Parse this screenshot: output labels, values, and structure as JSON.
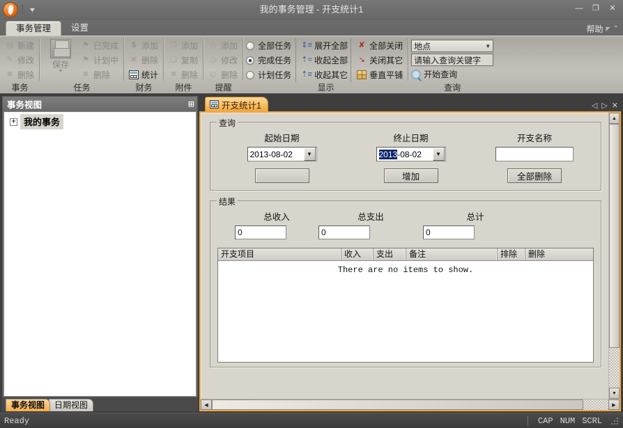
{
  "window": {
    "title": "我的事务管理 - 开支统计1",
    "minimize": "—",
    "maximize": "❐",
    "close": "✕",
    "quick_access_caret": "▼"
  },
  "ribbon": {
    "tabs": [
      {
        "label": "事务管理",
        "active": true
      },
      {
        "label": "设置",
        "active": false
      }
    ],
    "help_label": "帮助",
    "groups": [
      {
        "name": "事务",
        "items": [
          {
            "label": "新建",
            "icon": "new-document-icon",
            "glyph": "◰",
            "enabled": false
          },
          {
            "label": "修改",
            "icon": "edit-icon",
            "glyph": "✎",
            "enabled": false
          },
          {
            "label": "删除",
            "icon": "delete-icon",
            "glyph": "✖",
            "enabled": false
          }
        ]
      },
      {
        "name": "任务",
        "big": {
          "label": "保存",
          "icon": "save-disk-icon",
          "enabled": false
        },
        "items": [
          {
            "label": "已完成",
            "icon": "flag-done-icon",
            "glyph": "⚑",
            "enabled": false
          },
          {
            "label": "计划中",
            "icon": "flag-planned-icon",
            "glyph": "⚑",
            "enabled": false
          },
          {
            "label": "删除",
            "icon": "delete-icon",
            "glyph": "✖",
            "enabled": false
          }
        ]
      },
      {
        "name": "财务",
        "items": [
          {
            "label": "添加",
            "icon": "money-add-icon",
            "glyph": "$",
            "enabled": false
          },
          {
            "label": "删除",
            "icon": "money-delete-icon",
            "glyph": "✖",
            "enabled": false
          },
          {
            "label": "统计",
            "icon": "calculator-icon",
            "glyph": "",
            "enabled": true
          }
        ]
      },
      {
        "name": "附件",
        "items": [
          {
            "label": "添加",
            "icon": "attach-add-icon",
            "glyph": "❐",
            "enabled": false
          },
          {
            "label": "复制",
            "icon": "copy-icon",
            "glyph": "❐",
            "enabled": false
          },
          {
            "label": "删除",
            "icon": "attach-delete-icon",
            "glyph": "✖",
            "enabled": false
          }
        ]
      },
      {
        "name": "提醒",
        "items": [
          {
            "label": "添加",
            "icon": "clock-add-icon",
            "glyph": "◷",
            "enabled": false
          },
          {
            "label": "修改",
            "icon": "clock-edit-icon",
            "glyph": "◷",
            "enabled": false
          },
          {
            "label": "删除",
            "icon": "clock-delete-icon",
            "glyph": "◷",
            "enabled": false
          }
        ]
      },
      {
        "name": "显示",
        "radios": [
          {
            "label": "全部任务",
            "selected": false
          },
          {
            "label": "完成任务",
            "selected": true
          },
          {
            "label": "计划任务",
            "selected": false
          }
        ],
        "tree_items": [
          {
            "label": "展开全部",
            "icon": "expand-all-icon"
          },
          {
            "label": "收起全部",
            "icon": "collapse-all-icon"
          },
          {
            "label": "收起其它",
            "icon": "collapse-others-icon"
          }
        ],
        "window_items": [
          {
            "label": "全部关闭",
            "icon": "close-all-icon"
          },
          {
            "label": "关闭其它",
            "icon": "close-others-icon"
          },
          {
            "label": "垂直平铺",
            "icon": "tile-vertical-icon"
          }
        ]
      },
      {
        "name": "查询",
        "scope_value": "地点",
        "keyword_placeholder": "请输入查询关键字",
        "start_label": "开始查询"
      }
    ]
  },
  "sidebar": {
    "caption": "事务视图",
    "pin": "⊞",
    "tree": [
      {
        "label": "我的事务",
        "expander": "+",
        "selected": true
      }
    ],
    "tabs": [
      {
        "label": "事务视图",
        "active": true
      },
      {
        "label": "日期视图",
        "active": false
      }
    ]
  },
  "document": {
    "tab": {
      "label": "开支统计1",
      "icon": "calculator-icon"
    },
    "nav": {
      "prev": "◁",
      "next": "▷",
      "close": "✕"
    },
    "query_group": {
      "title": "查询",
      "start_date": {
        "label": "起始日期",
        "value": "2013-08-02",
        "selection": ""
      },
      "end_date": {
        "label": "终止日期",
        "value": "2013-08-02",
        "selection": "2013",
        "rest": "-08-02"
      },
      "expense_name": {
        "label": "开支名称",
        "value": "",
        "placeholder": ""
      },
      "buttons": [
        {
          "label": "",
          "name": "query-blank-button"
        },
        {
          "label": "增加",
          "name": "add-button"
        },
        {
          "label": "全部删除",
          "name": "delete-all-button"
        }
      ]
    },
    "result_group": {
      "title": "结果",
      "totals": [
        {
          "label": "总收入",
          "value": "0"
        },
        {
          "label": "总支出",
          "value": "0"
        },
        {
          "label": "总计",
          "value": "0"
        }
      ],
      "grid": {
        "columns": [
          "开支项目",
          "收入",
          "支出",
          "备注",
          "排除",
          "删除"
        ],
        "rows": [],
        "empty_message": "There are no items to show."
      }
    }
  },
  "statusbar": {
    "message": "Ready",
    "indicators": [
      "CAP",
      "NUM",
      "SCRL"
    ]
  },
  "colors": {
    "accent_orange": "#f0a945",
    "chrome_gray": "#6e6e6e",
    "face": "#d8d5cd",
    "selection_blue": "#0a246a"
  }
}
